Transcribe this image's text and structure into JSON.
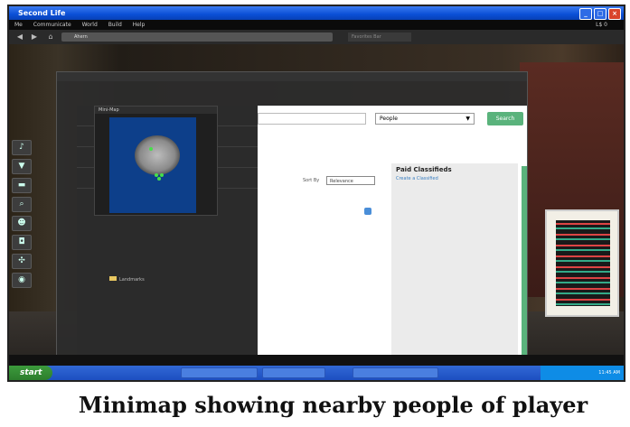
{
  "window": {
    "title": "Second Life"
  },
  "menubar": {
    "items": [
      "Me",
      "Communicate",
      "World",
      "Build",
      "Help"
    ],
    "right_text": "L$ 0"
  },
  "navbar": {
    "address": "Ahern",
    "favorites": "Favorites Bar"
  },
  "search_dialog": {
    "people_option": "People",
    "search_button": "Search",
    "sort_label": "Sort By",
    "sort_value": "Relevance",
    "classifieds_title": "Paid Classifieds",
    "classifieds_link": "Create a Classified"
  },
  "minimap": {
    "title": "Mini-Map",
    "nearby_people_count": 4
  },
  "inventory": {
    "folder": "Landmarks"
  },
  "taskbar": {
    "start": "start",
    "time": "11:45 AM"
  },
  "caption": "Minimap showing nearby people of  player",
  "colors": {
    "search_button": "#5ab37c",
    "map_water": "#0d3f8a",
    "avatar_dots": "#46e04a"
  }
}
